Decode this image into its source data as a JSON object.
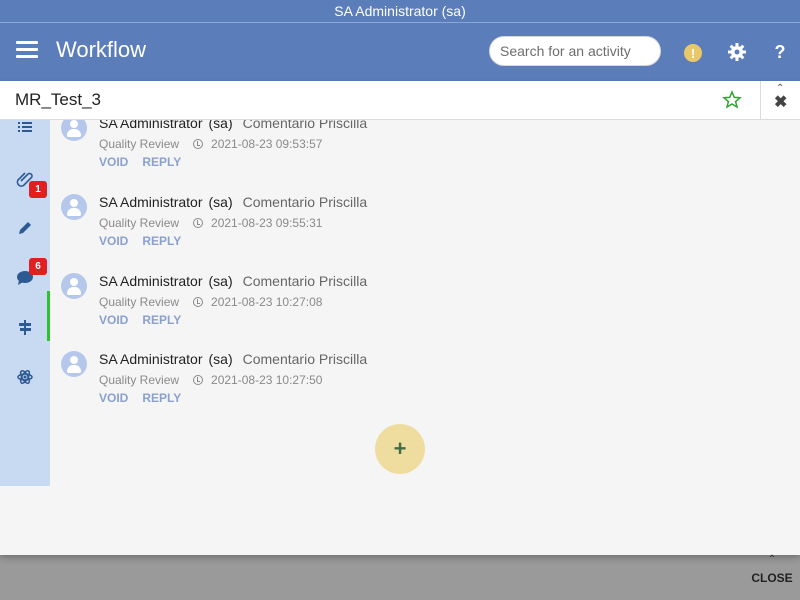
{
  "window": {
    "title": "SA Administrator  (sa)"
  },
  "header": {
    "menu_icon": "hamburger-icon",
    "title": "Workflow",
    "search_placeholder": "Search for an activity",
    "icons": [
      "warning-icon",
      "gear-icon",
      "help-icon"
    ],
    "help_glyph": "?",
    "warning_glyph": "!"
  },
  "record": {
    "title": "MR_Test_3",
    "star_icon": "star-outline-icon",
    "close_icon": "close-icon"
  },
  "sidebar": {
    "items": [
      {
        "icon": "list-icon"
      },
      {
        "icon": "paperclip-icon",
        "badge": "1"
      },
      {
        "icon": "pencil-icon"
      },
      {
        "icon": "comment-icon",
        "badge": "6",
        "active": true
      },
      {
        "icon": "signpost-icon"
      },
      {
        "icon": "atom-icon"
      }
    ]
  },
  "comments": [
    {
      "author": "SA Administrator",
      "user": "(sa)",
      "text": "Comentario Priscilla",
      "stage": "Quality Review",
      "timestamp": "2021-08-23 09:53:57",
      "void_label": "VOID",
      "reply_label": "REPLY"
    },
    {
      "author": "SA Administrator",
      "user": "(sa)",
      "text": "Comentario Priscilla",
      "stage": "Quality Review",
      "timestamp": "2021-08-23 09:55:31",
      "void_label": "VOID",
      "reply_label": "REPLY"
    },
    {
      "author": "SA Administrator",
      "user": "(sa)",
      "text": "Comentario Priscilla",
      "stage": "Quality Review",
      "timestamp": "2021-08-23 10:27:08",
      "void_label": "VOID",
      "reply_label": "REPLY"
    },
    {
      "author": "SA Administrator",
      "user": "(sa)",
      "text": "Comentario Priscilla",
      "stage": "Quality Review",
      "timestamp": "2021-08-23 10:27:50",
      "void_label": "VOID",
      "reply_label": "REPLY"
    }
  ],
  "add_button": {
    "label": "+"
  },
  "footer": {
    "close_label": "CLOSE"
  },
  "colors": {
    "header": "#5b7db9",
    "sidebar": "#c8d9f2",
    "badge": "#e02020",
    "active_indicator": "#2ec22e",
    "add_button": "#efdda0",
    "action_link": "#8aa0cf",
    "warning": "#e8c86a"
  }
}
